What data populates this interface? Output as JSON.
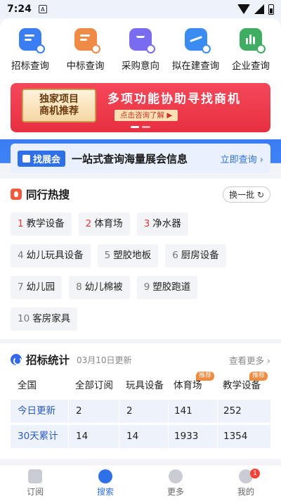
{
  "status_bar": {
    "time": "7:24",
    "notif_glyph": "A"
  },
  "quick_nav": [
    {
      "label": "招标查询",
      "icon": "document-bidding-icon",
      "color": "#3b7df2"
    },
    {
      "label": "中标查询",
      "icon": "checklist-icon",
      "color": "#f08a47"
    },
    {
      "label": "采购意向",
      "icon": "shopping-bag-icon",
      "color": "#7a6cf0"
    },
    {
      "label": "拟在建查询",
      "icon": "trend-chart-icon",
      "color": "#3b8cf2"
    },
    {
      "label": "企业查询",
      "icon": "bar-chart-icon",
      "color": "#3fae62"
    }
  ],
  "banner": {
    "badge_line1": "独家项目",
    "badge_line2": "商机推荐",
    "title": "多项功能协助寻找商机",
    "cta": "点击咨询了解 ▶"
  },
  "expo": {
    "tag": "找展会",
    "text": "一站式查询海量展会信息",
    "link": "立即查询 ›"
  },
  "hot": {
    "title": "同行热搜",
    "swap": "换一批 ↻",
    "rows": [
      [
        {
          "rank": "1",
          "label": "教学设备"
        },
        {
          "rank": "2",
          "label": "体育场"
        },
        {
          "rank": "3",
          "label": "净水器"
        }
      ],
      [
        {
          "rank": "4",
          "label": "幼儿玩具设备"
        },
        {
          "rank": "5",
          "label": "塑胶地板"
        },
        {
          "rank": "6",
          "label": "厨房设备"
        }
      ],
      [
        {
          "rank": "7",
          "label": "幼儿园"
        },
        {
          "rank": "8",
          "label": "幼儿棉被"
        },
        {
          "rank": "9",
          "label": "塑胶跑道"
        }
      ],
      [
        {
          "rank": "10",
          "label": "客房家具"
        }
      ]
    ]
  },
  "stats": {
    "title": "招标统计",
    "date": "03月10日更新",
    "more": "查看更多 ›",
    "headers": [
      "全国",
      "全部订阅",
      "玩具设备",
      "体育场",
      "教学设备"
    ],
    "recommend_badge": "推荐",
    "rows": [
      {
        "name": "今日更新",
        "values": [
          "2",
          "2",
          "141",
          "252"
        ]
      },
      {
        "name": "30天累计",
        "values": [
          "14",
          "14",
          "1933",
          "1354"
        ]
      }
    ]
  },
  "bottom_nav": {
    "items": [
      "订阅",
      "搜索",
      "更多",
      "我的"
    ],
    "badge": "1"
  }
}
